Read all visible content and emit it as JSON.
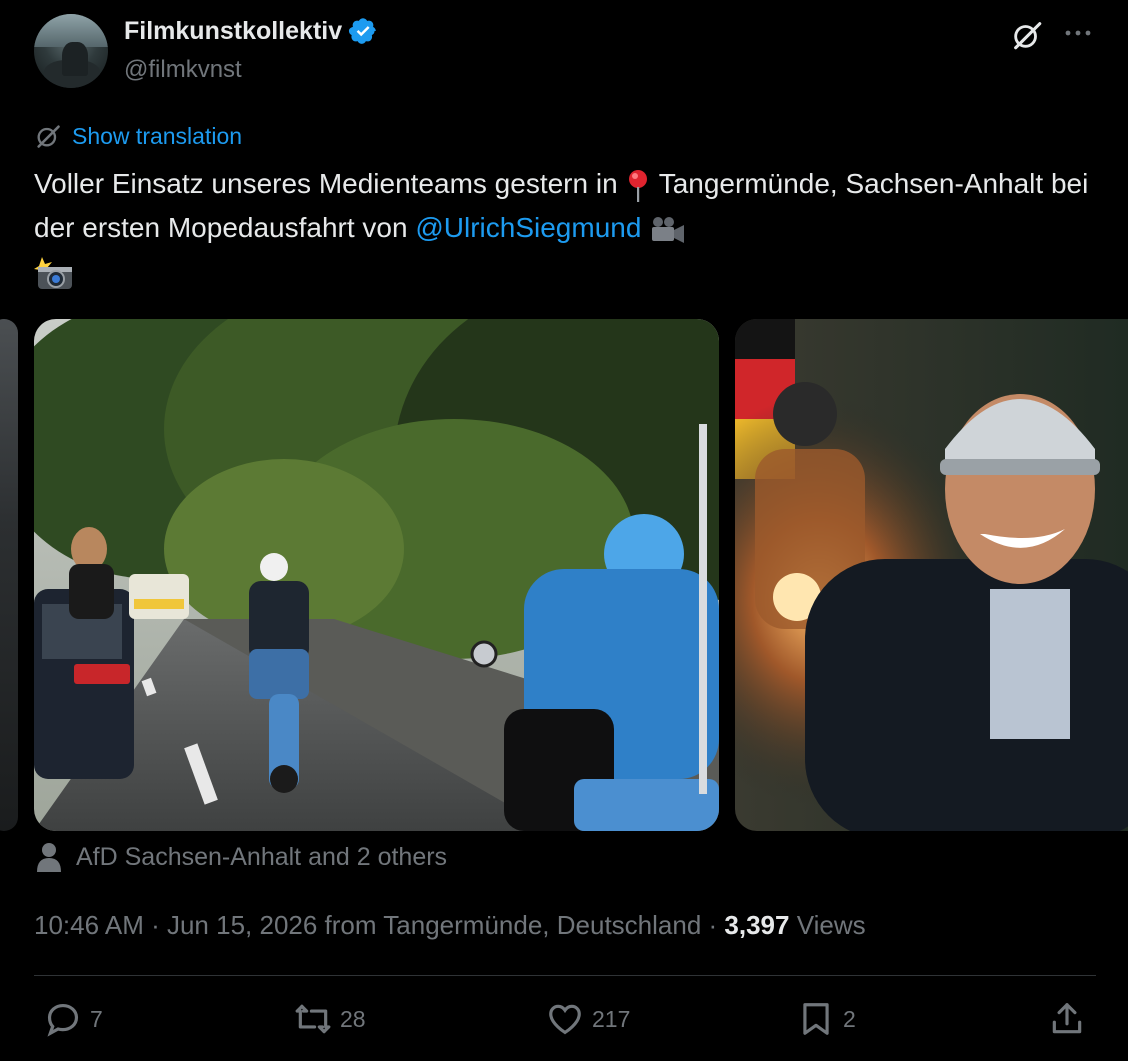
{
  "author": {
    "name": "Filmkunstkollektiv",
    "handle": "@filmkvnst",
    "verified": true
  },
  "translation_label": "Show translation",
  "tweet": {
    "text_part1": "Voller Einsatz unseres Medienteams gestern in ",
    "text_part2": " Tangermünde, Sachsen-Anhalt bei der ersten Mopedausfahrt von ",
    "mention": "@UlrichSiegmund",
    "icons": [
      "round-pushpin-icon",
      "movie-camera-icon",
      "camera-with-flash-icon"
    ]
  },
  "tagged": "AfD Sachsen-Anhalt and 2 others",
  "meta": {
    "time": "10:46 AM",
    "separator": " · ",
    "date": "Jun 15, 2026",
    "location": " from Tangermünde, Deutschland",
    "views_count": "3,397",
    "views_label": " Views"
  },
  "actions": {
    "replies": "7",
    "reposts": "28",
    "likes": "217",
    "bookmarks": "2"
  },
  "colors": {
    "background": "#000000",
    "text": "#e7e9ea",
    "muted": "#71767b",
    "accent": "#1d9bf0",
    "divider": "#2f3336"
  }
}
